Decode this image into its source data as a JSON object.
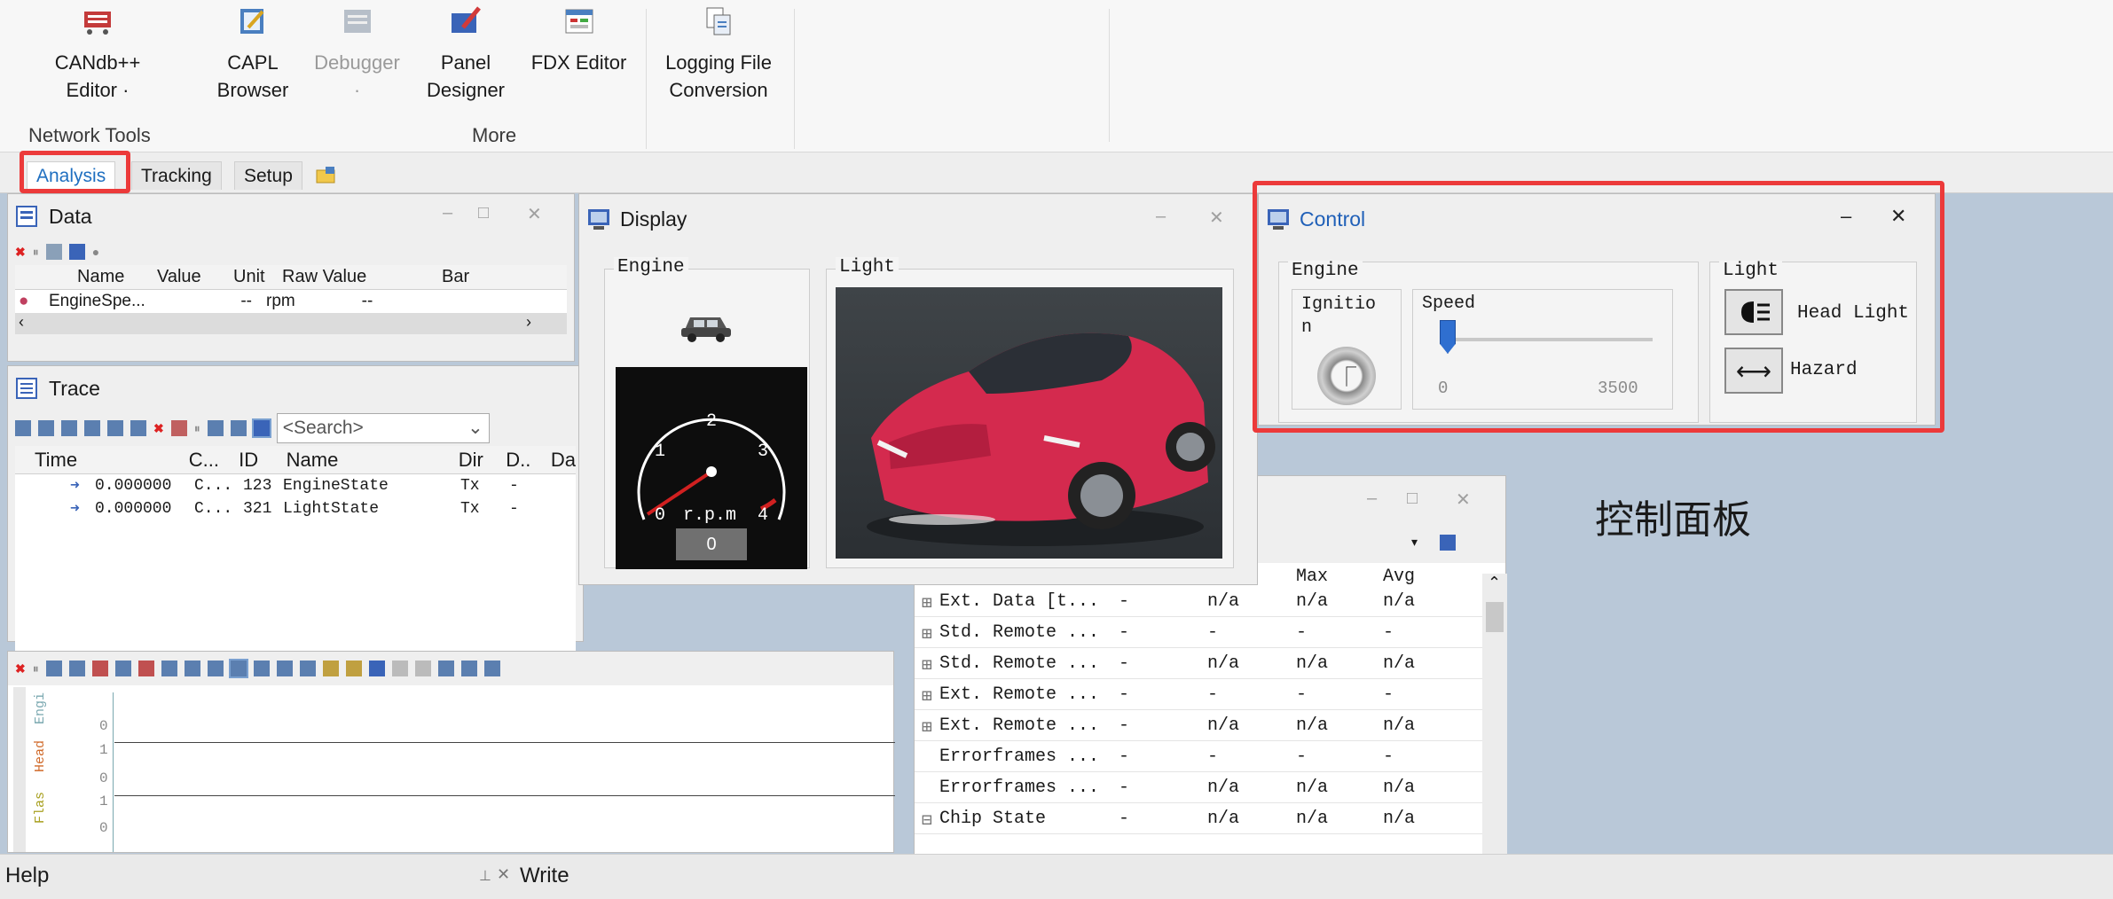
{
  "ribbon": {
    "buttons": [
      {
        "id": "candb",
        "l1": "CANdb++",
        "l2": "Editor ·",
        "icon": "candb-editor-icon",
        "disabled": false
      },
      {
        "id": "capl",
        "l1": "CAPL",
        "l2": "Browser",
        "icon": "capl-browser-icon",
        "disabled": false
      },
      {
        "id": "debugger",
        "l1": "Debugger",
        "l2": "·",
        "icon": "debugger-icon",
        "disabled": true
      },
      {
        "id": "panel",
        "l1": "Panel",
        "l2": "Designer",
        "icon": "panel-designer-icon",
        "disabled": false
      },
      {
        "id": "fdx",
        "l1": "FDX Editor",
        "l2": "",
        "icon": "fdx-editor-icon",
        "disabled": false
      },
      {
        "id": "logging",
        "l1": "Logging File",
        "l2": "Conversion",
        "icon": "logging-conversion-icon",
        "disabled": false
      }
    ],
    "groups": [
      "Network Tools",
      "More"
    ]
  },
  "tabs": [
    "Analysis",
    "Tracking",
    "Setup"
  ],
  "data_window": {
    "title": "Data",
    "columns": [
      "Name",
      "Value",
      "Unit",
      "Raw Value",
      "Bar"
    ],
    "row": {
      "name": "EngineSpe...",
      "value": "--",
      "unit": "rpm",
      "raw": "--"
    }
  },
  "trace_window": {
    "title": "Trace",
    "search_placeholder": "<Search>",
    "columns": [
      "Time",
      "C...",
      "ID",
      "Name",
      "Dir",
      "D..",
      "Da"
    ],
    "rows": [
      {
        "time": "0.000000",
        "chan": "C...",
        "id": "123",
        "name": "EngineState",
        "dir": "Tx",
        "d": "-"
      },
      {
        "time": "0.000000",
        "chan": "C...",
        "id": "321",
        "name": "LightState",
        "dir": "Tx",
        "d": "-"
      }
    ]
  },
  "graphics_window": {
    "signals": [
      {
        "name": "Engi"
      },
      {
        "name": "Head"
      },
      {
        "name": "Flas"
      }
    ],
    "ticks": [
      "0",
      "1",
      "0",
      "1",
      "0"
    ]
  },
  "display_window": {
    "title": "Display",
    "engine_label": "Engine",
    "light_label": "Light",
    "gauge": {
      "ticks": [
        "0",
        "1",
        "2",
        "3",
        "4"
      ],
      "unit": "r.p.m",
      "value": "0"
    }
  },
  "control_window": {
    "title": "Control",
    "engine_label": "Engine",
    "ignition_label": "Ignitio\nn",
    "speed_label": "Speed",
    "speed_min": "0",
    "speed_max": "3500",
    "speed_value_fraction": 0.0,
    "light_label": "Light",
    "head_light_label": "Head Light",
    "hazard_label": "Hazard"
  },
  "annotation": "控制面板",
  "stats_window": {
    "columns": [
      "Max",
      "Avg"
    ],
    "rows": [
      {
        "name": "Ext. Data [t...",
        "c1": "-",
        "c2": "n/a",
        "c3": "n/a",
        "c4": "n/a",
        "exp": "⊞"
      },
      {
        "name": "Std. Remote ...",
        "c1": "-",
        "c2": "-",
        "c3": "-",
        "c4": "-",
        "exp": "⊞"
      },
      {
        "name": "Std. Remote ...",
        "c1": "-",
        "c2": "n/a",
        "c3": "n/a",
        "c4": "n/a",
        "exp": "⊞"
      },
      {
        "name": "Ext. Remote ...",
        "c1": "-",
        "c2": "-",
        "c3": "-",
        "c4": "-",
        "exp": "⊞"
      },
      {
        "name": "Ext. Remote ...",
        "c1": "-",
        "c2": "n/a",
        "c3": "n/a",
        "c4": "n/a",
        "exp": "⊞"
      },
      {
        "name": "Errorframes ...",
        "c1": "-",
        "c2": "-",
        "c3": "-",
        "c4": "-",
        "exp": ""
      },
      {
        "name": "Errorframes ...",
        "c1": "-",
        "c2": "n/a",
        "c3": "n/a",
        "c4": "n/a",
        "exp": ""
      },
      {
        "name": "Chip State",
        "c1": "-",
        "c2": "n/a",
        "c3": "n/a",
        "c4": "n/a",
        "exp": "⊟"
      }
    ]
  },
  "bottom": {
    "help": "Help",
    "write": "Write"
  }
}
